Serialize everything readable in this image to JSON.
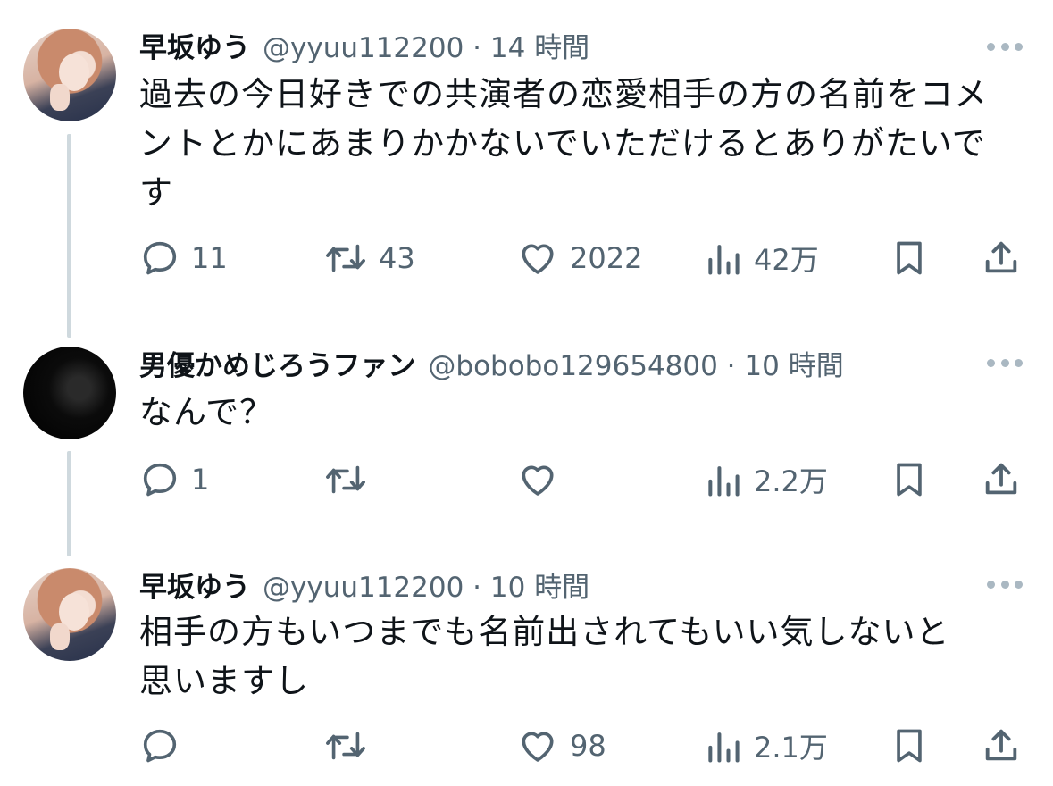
{
  "tweets": [
    {
      "name": "早坂ゆう",
      "handle_time": "@yyuu112200 · 14 時間",
      "lines": [
        "過去の今日好きでの共演者の恋愛相手の方の名前をコメ",
        "ントとかにあまりかかないでいただけるとありがたいで",
        "す"
      ],
      "actions": {
        "reply": "11",
        "retweet": "43",
        "like": "2022",
        "views": "42万"
      }
    },
    {
      "name": "男優かめじろうファン",
      "handle_time": "@bobobo129654800 · 10 時間",
      "lines": [
        "なんで？"
      ],
      "actions": {
        "reply": "1",
        "retweet": "",
        "like": "",
        "views": "2.2万"
      }
    },
    {
      "name": "早坂ゆう",
      "handle_time": "@yyuu112200 · 10 時間",
      "lines": [
        "相手の方もいつまでも名前出されてもいい気しないと",
        "思いますし"
      ],
      "actions": {
        "reply": "",
        "retweet": "",
        "like": "98",
        "views": "2.1万"
      }
    }
  ],
  "icons": {
    "reply": "reply-icon",
    "retweet": "retweet-icon",
    "like": "heart-icon",
    "views": "views-icon",
    "bookmark": "bookmark-icon",
    "share": "share-icon",
    "more": "more-icon"
  },
  "colors": {
    "text": "#0f1419",
    "secondary": "#536471",
    "thread_line": "#cfd9de"
  }
}
